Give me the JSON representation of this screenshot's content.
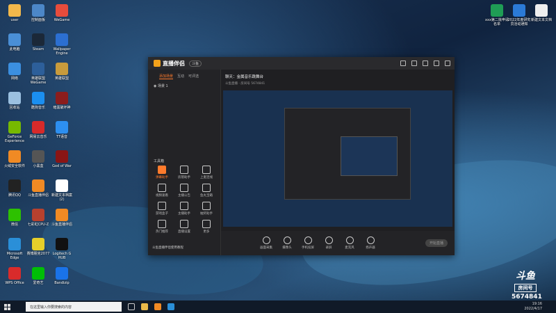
{
  "desktop_icons": [
    {
      "label": "user",
      "color": "#f2b84b"
    },
    {
      "label": "此电脑",
      "color": "#4a8fd6"
    },
    {
      "label": "网络",
      "color": "#3b8fe0"
    },
    {
      "label": "回收站",
      "color": "#9bc0e0"
    },
    {
      "label": "GeForce Experience",
      "color": "#76b900"
    },
    {
      "label": "火绒安全软件",
      "color": "#f08a24"
    },
    {
      "label": "腾讯QQ",
      "color": "#222222"
    },
    {
      "label": "微信",
      "color": "#2dc100"
    },
    {
      "label": "Microsoft Edge",
      "color": "#2a8fd8"
    },
    {
      "label": "WPS Office",
      "color": "#d92b2b"
    },
    {
      "label": "控制面板",
      "color": "#4c87c8"
    },
    {
      "label": "Steam",
      "color": "#1b2838"
    },
    {
      "label": "英雄联盟WeGame",
      "color": "#2d5f9a"
    },
    {
      "label": "酷狗音乐",
      "color": "#1b8ff0"
    },
    {
      "label": "网易云音乐",
      "color": "#d62a2a"
    },
    {
      "label": "小黑盒",
      "color": "#555555"
    },
    {
      "label": "斗鱼直播伴侣",
      "color": "#f08a24"
    },
    {
      "label": "七彩虹CPU-Z",
      "color": "#b7412e"
    },
    {
      "label": "赛博朋克2077",
      "color": "#e6cf2a"
    },
    {
      "label": "爱奇艺",
      "color": "#00be06"
    },
    {
      "label": "WeGame",
      "color": "#e74c3c"
    },
    {
      "label": "Wallpaper Engine",
      "color": "#2c6fd1"
    },
    {
      "label": "英雄联盟",
      "color": "#c89b3c"
    },
    {
      "label": "暗黑破坏神",
      "color": "#8b1d1d"
    },
    {
      "label": "TT语音",
      "color": "#2d8ff0"
    },
    {
      "label": "God of War",
      "color": "#8a1515"
    },
    {
      "label": "新建文本档案(2)",
      "color": "#ffffff"
    },
    {
      "label": "斗鱼直播伴侣",
      "color": "#f08a24"
    },
    {
      "label": "Logitech G HUB",
      "color": "#111111"
    },
    {
      "label": "Bandizip",
      "color": "#1a73e8"
    }
  ],
  "top_right_icons": [
    {
      "label": "xxx第二批申请名单",
      "color": "#1f9d55"
    },
    {
      "label": "2022年度研究员活动通知",
      "color": "#2b7ad6"
    },
    {
      "label": "新建文本文档",
      "color": "#eeeeee"
    }
  ],
  "app": {
    "name": "直播伴侣",
    "version_badge": "斗鱼",
    "side_tabs": [
      "添加场景",
      "互动",
      "可评选"
    ],
    "scene": "场景 1",
    "tools_header": "工具箱",
    "tools": [
      "弹幕助手",
      "房管助手",
      "上麦连线",
      "视频速看",
      "主播公告",
      "鱼丸宝箱",
      "游戏盒子",
      "主播助手",
      "抽奖助手",
      "热门推荐",
      "直播设置",
      "更多"
    ],
    "side_footer": "斗鱼直播伴侣使用教程",
    "room_title": "聊天：金属音乐跳舞台",
    "room_meta": "斗鱼直播 · 房间号 5674841",
    "bottom_buttons": [
      "画面采集",
      "摄像头",
      "手机投屏",
      "录屏",
      "麦克风",
      "扬声器"
    ],
    "start_live": "开始直播"
  },
  "badge": {
    "brand": "斗鱼",
    "label": "房间号",
    "room": "5674841"
  },
  "taskbar": {
    "search_placeholder": "在这里输入你要搜索的内容",
    "time": "19:16",
    "date": "2022/4/17"
  }
}
